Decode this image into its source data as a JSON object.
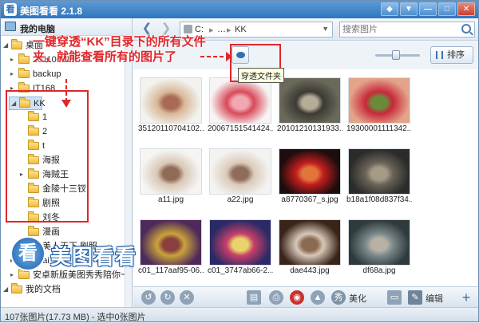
{
  "window": {
    "title": "美图看看 2.1.8",
    "logo_glyph": "看"
  },
  "sidebar": {
    "header": "我的电脑",
    "items": [
      {
        "label": "桌面",
        "level": 0
      },
      {
        "label": "20110511",
        "level": 1
      },
      {
        "label": "backup",
        "level": 1
      },
      {
        "label": "IT168",
        "level": 1
      },
      {
        "label": "KK",
        "level": 1,
        "selected": true
      },
      {
        "label": "1",
        "level": 2
      },
      {
        "label": "2",
        "level": 2
      },
      {
        "label": "t",
        "level": 2
      },
      {
        "label": "海报",
        "level": 2
      },
      {
        "label": "海贼王",
        "level": 2
      },
      {
        "label": "金陵十三钗",
        "level": 2
      },
      {
        "label": "剧照",
        "level": 2
      },
      {
        "label": "刘冬",
        "level": 2
      },
      {
        "label": "漫画",
        "level": 2
      },
      {
        "label": "美人天下 剧照",
        "level": 2
      },
      {
        "label": "qdai",
        "level": 1
      },
      {
        "label": "安卓新版美图秀秀陪你一起晒晒",
        "level": 1
      },
      {
        "label": "我的文档",
        "level": 0
      }
    ]
  },
  "toolbar": {
    "back_glyph": "❮",
    "forward_glyph": "❯",
    "path": {
      "drive": "C:",
      "ellipsis": "…",
      "folder": "KK"
    },
    "search_placeholder": "搜索图片"
  },
  "bar2": {
    "tooltip": "穿透文件夹",
    "sort_label": "排序",
    "zoom_level": 0.45
  },
  "annotation": {
    "text": "一键穿透“KK”目录下的所有文件夹，就能查看所有的图片了"
  },
  "brand": {
    "text": "美图看看",
    "glyph": "看"
  },
  "grid": {
    "files": [
      {
        "name": "35120110704102...",
        "colors": [
          "#f2f2ee",
          "#d8b899",
          "#a86a55"
        ]
      },
      {
        "name": "20067151541424...",
        "colors": [
          "#f6f4f4",
          "#d84a58",
          "#f2a8b2"
        ]
      },
      {
        "name": "20101210131933...",
        "colors": [
          "#6b6a5a",
          "#3c3a33",
          "#b6ad97"
        ]
      },
      {
        "name": "19300001111342...",
        "colors": [
          "#e3a48a",
          "#c7283a",
          "#6d8a3a"
        ]
      },
      {
        "name": "a11.jpg",
        "colors": [
          "#f5f5f3",
          "#d9c7b6",
          "#8f6a56"
        ]
      },
      {
        "name": "a22.jpg",
        "colors": [
          "#f3f3f1",
          "#dbcaba",
          "#906d5a"
        ]
      },
      {
        "name": "a8770367_s.jpg",
        "colors": [
          "#1e0d0d",
          "#c21e1e",
          "#e2763a"
        ]
      },
      {
        "name": "b18a1f08d837f34...",
        "colors": [
          "#2b2b2b",
          "#6a6458",
          "#a69a86"
        ]
      },
      {
        "name": "c01_117aaf95-06...",
        "colors": [
          "#4e2a5a",
          "#c9a43a",
          "#8a3f3f"
        ]
      },
      {
        "name": "c01_3747ab66-2...",
        "colors": [
          "#2c2a66",
          "#c83f6a",
          "#e8d46a"
        ]
      },
      {
        "name": "dae443.jpg",
        "colors": [
          "#3a2418",
          "#d7c8b8",
          "#8a6a50"
        ]
      },
      {
        "name": "df68a.jpg",
        "colors": [
          "#2f3a3d",
          "#7c8a8c",
          "#b8b2a6"
        ]
      }
    ]
  },
  "bottombar": {
    "beautify_label": "美化",
    "edit_label": "编辑"
  },
  "status": {
    "text": "107张图片(17.73 MB) - 选中0张图片"
  }
}
